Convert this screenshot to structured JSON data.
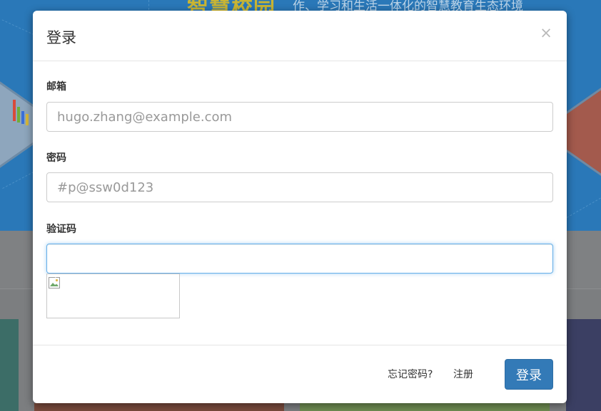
{
  "background": {
    "banner_title": "智慧校园",
    "banner_subtitle": "作、学习和生活一体化的智慧教育生态环境"
  },
  "modal": {
    "title": "登录",
    "close_label": "×",
    "fields": {
      "email": {
        "label": "邮箱",
        "placeholder": "hugo.zhang@example.com",
        "value": ""
      },
      "password": {
        "label": "密码",
        "placeholder": "#p@ssw0d123",
        "value": ""
      },
      "captcha": {
        "label": "验证码",
        "placeholder": "",
        "value": ""
      }
    },
    "footer": {
      "forgot_label": "忘记密码?",
      "register_label": "注册",
      "login_label": "登录"
    }
  },
  "colors": {
    "primary": "#337ab7",
    "focus_border": "#66afe9"
  }
}
